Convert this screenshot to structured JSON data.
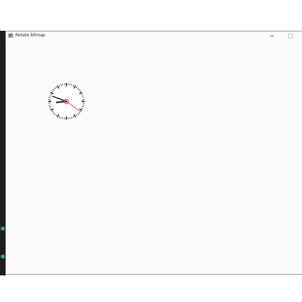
{
  "window": {
    "title": "Rotate bitmap",
    "icon": "app-icon",
    "buttons": [
      "minimize-icon",
      "maximize-icon"
    ]
  },
  "clock": {
    "hour": 8,
    "minute": 48,
    "second": 21
  },
  "colors": {
    "second_hand": "#d84a4a",
    "hand": "#2a2a2a",
    "face": "#ffffff"
  }
}
